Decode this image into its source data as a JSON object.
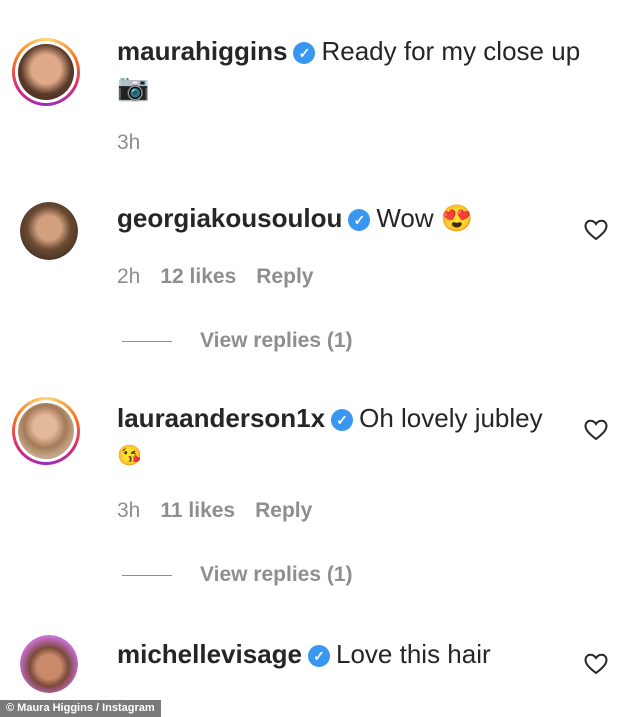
{
  "post": {
    "username": "maurahiggins",
    "caption": "Ready for my close up",
    "caption_emoji": "📷",
    "time": "3h"
  },
  "comments": [
    {
      "username": "georgiakousoulou",
      "text": "Wow",
      "emoji": "😍",
      "time": "2h",
      "likes": "12 likes",
      "reply": "Reply",
      "view_replies": "View replies (1)"
    },
    {
      "username": "lauraanderson1x",
      "text": "Oh lovely jubley",
      "emoji": "😘",
      "time": "3h",
      "likes": "11 likes",
      "reply": "Reply",
      "view_replies": "View replies (1)"
    },
    {
      "username": "michellevisage",
      "text": "Love this hair"
    }
  ],
  "credit": "© Maura Higgins / Instagram",
  "colors": {
    "verified": "#3897f0",
    "meta": "#8e8e8e",
    "text": "#262626"
  },
  "icons": {
    "verified": "verified-badge-icon",
    "like": "heart-outline-icon"
  }
}
